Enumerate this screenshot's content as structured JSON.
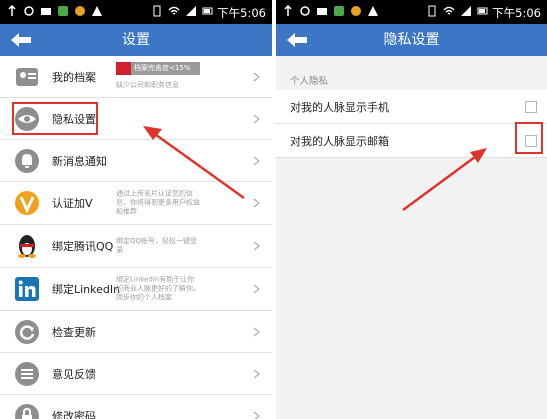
{
  "status_bar": {
    "time": "下午5:06"
  },
  "left_screen": {
    "title": "设置",
    "items": [
      {
        "label": "我的档案",
        "progress_text": "档案完善度<15%",
        "progress": 0.18,
        "subtitle": "缺少公司和职务信息",
        "icon": "profile-card-icon"
      },
      {
        "label": "隐私设置",
        "icon": "eye-icon"
      },
      {
        "label": "新消息通知",
        "icon": "bell-icon"
      },
      {
        "label": "认证加V",
        "desc": "通过上传名片认证您的信息，你将得到更多用户权益和推荐",
        "icon": "v-badge-icon"
      },
      {
        "label": "绑定腾讯QQ",
        "desc": "绑定QQ帐号，轻松一键登录",
        "icon": "qq-penguin-icon"
      },
      {
        "label": "绑定LinkedIn",
        "desc": "绑定Linkedin有助于让你的商业人脉更好的了解你，同步你的个人档案",
        "icon": "linkedin-icon"
      },
      {
        "label": "检查更新",
        "icon": "refresh-icon"
      },
      {
        "label": "意见反馈",
        "icon": "feedback-icon"
      },
      {
        "label": "修改密码",
        "icon": "lock-icon"
      }
    ]
  },
  "right_screen": {
    "title": "隐私设置",
    "section": "个人隐私",
    "options": [
      {
        "label": "对我的人脉显示手机",
        "checked": false
      },
      {
        "label": "对我的人脉显示邮箱",
        "checked": false
      }
    ]
  },
  "colors": {
    "header": "#3c76c5",
    "highlight": "#e0332e"
  }
}
